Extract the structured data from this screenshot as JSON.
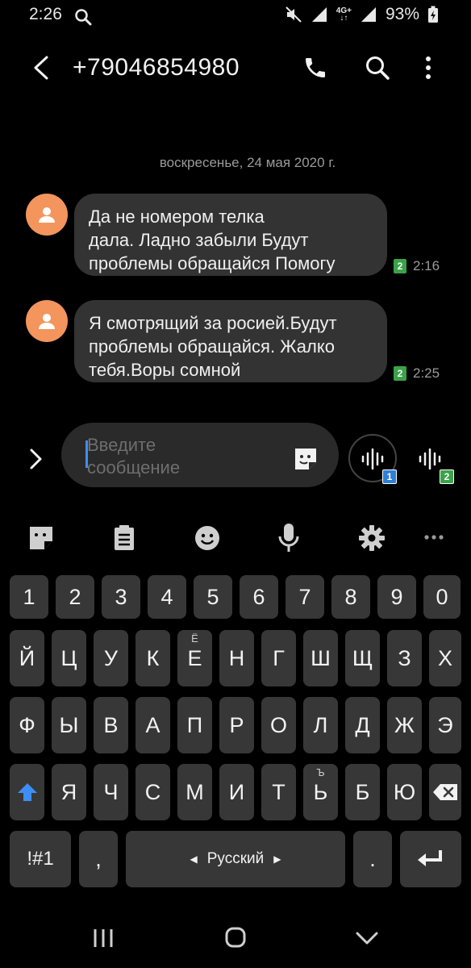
{
  "status": {
    "time": "2:26",
    "network": "4G+",
    "battery": "93%"
  },
  "header": {
    "phone_number": "+79046854980"
  },
  "date_separator": "воскресенье, 24 мая 2020 г.",
  "messages": [
    {
      "text_lines": [
        "Да не номером телка",
        "дала. Ладно забыли Будут",
        "проблемы обращайся Помогу"
      ],
      "sim": "2",
      "time": "2:16"
    },
    {
      "text_lines": [
        "Я смотрящий за росией.Будут",
        "проблемы обращайся. Жалко",
        "тебя.Воры сомной"
      ],
      "sim": "2",
      "time": "2:25"
    }
  ],
  "composer": {
    "placeholder_lines": [
      "Введите",
      "сообщение"
    ],
    "voice_sim1": "1",
    "voice_sim2": "2"
  },
  "keyboard": {
    "row_numbers": [
      "1",
      "2",
      "3",
      "4",
      "5",
      "6",
      "7",
      "8",
      "9",
      "0"
    ],
    "row1": [
      "Й",
      "Ц",
      "У",
      "К",
      "Е",
      "Н",
      "Г",
      "Ш",
      "Щ",
      "З",
      "Х"
    ],
    "row1_alt_e": "Ё",
    "row2": [
      "Ф",
      "Ы",
      "В",
      "А",
      "П",
      "Р",
      "О",
      "Л",
      "Д",
      "Ж",
      "Э"
    ],
    "row3": [
      "Я",
      "Ч",
      "С",
      "М",
      "И",
      "Т",
      "Ь",
      "Б",
      "Ю"
    ],
    "row3_alt_soft": "Ъ",
    "symbols_key": "!#1",
    "comma_key": ",",
    "period_key": ".",
    "language": "Русский"
  },
  "colors": {
    "accent": "#3e8ef7",
    "avatar": "#f3955d",
    "sim_badge_green": "#3aa34a",
    "sim_badge_blue": "#2e7fd8"
  }
}
